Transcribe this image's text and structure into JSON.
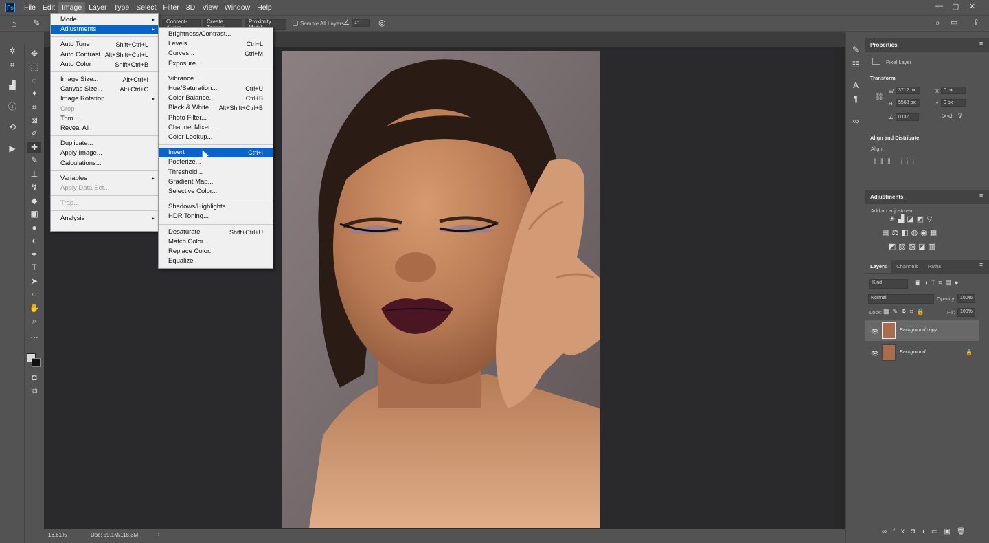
{
  "app": {
    "logo": "Ps"
  },
  "menubar": {
    "items": [
      "File",
      "Edit",
      "Image",
      "Layer",
      "Type",
      "Select",
      "Filter",
      "3D",
      "View",
      "Window",
      "Help"
    ],
    "active": "Image"
  },
  "options": {
    "content_aware": "Content-Aware",
    "create_texture": "Create Texture",
    "proximity_match": "Proximity Match",
    "sample_all_layers": "Sample All Layers",
    "angle": "1°"
  },
  "status": {
    "zoom": "16.61%",
    "doc": "Doc: 59.1M/118.3M"
  },
  "image_menu": [
    {
      "label": "Mode",
      "sub": true
    },
    {
      "label": "Adjustments",
      "sub": true,
      "highlight": true
    },
    {
      "sep": true
    },
    {
      "label": "Auto Tone",
      "shortcut": "Shift+Ctrl+L"
    },
    {
      "label": "Auto Contrast",
      "shortcut": "Alt+Shift+Ctrl+L"
    },
    {
      "label": "Auto Color",
      "shortcut": "Shift+Ctrl+B"
    },
    {
      "sep": true
    },
    {
      "label": "Image Size...",
      "shortcut": "Alt+Ctrl+I"
    },
    {
      "label": "Canvas Size...",
      "shortcut": "Alt+Ctrl+C"
    },
    {
      "label": "Image Rotation",
      "sub": true
    },
    {
      "label": "Crop",
      "disabled": true
    },
    {
      "label": "Trim..."
    },
    {
      "label": "Reveal All"
    },
    {
      "sep": true
    },
    {
      "label": "Duplicate..."
    },
    {
      "label": "Apply Image..."
    },
    {
      "label": "Calculations..."
    },
    {
      "sep": true
    },
    {
      "label": "Variables",
      "sub": true
    },
    {
      "label": "Apply Data Set...",
      "disabled": true
    },
    {
      "sep": true
    },
    {
      "label": "Trap...",
      "disabled": true
    },
    {
      "sep": true
    },
    {
      "label": "Analysis",
      "sub": true
    }
  ],
  "adjustments_menu": [
    {
      "label": "Brightness/Contrast..."
    },
    {
      "label": "Levels...",
      "shortcut": "Ctrl+L"
    },
    {
      "label": "Curves...",
      "shortcut": "Ctrl+M"
    },
    {
      "label": "Exposure..."
    },
    {
      "sep": true
    },
    {
      "label": "Vibrance..."
    },
    {
      "label": "Hue/Saturation...",
      "shortcut": "Ctrl+U"
    },
    {
      "label": "Color Balance...",
      "shortcut": "Ctrl+B"
    },
    {
      "label": "Black & White...",
      "shortcut": "Alt+Shift+Ctrl+B"
    },
    {
      "label": "Photo Filter..."
    },
    {
      "label": "Channel Mixer..."
    },
    {
      "label": "Color Lookup..."
    },
    {
      "sep": true
    },
    {
      "label": "Invert",
      "shortcut": "Ctrl+I",
      "highlight": true
    },
    {
      "label": "Posterize..."
    },
    {
      "label": "Threshold..."
    },
    {
      "label": "Gradient Map..."
    },
    {
      "label": "Selective Color..."
    },
    {
      "sep": true
    },
    {
      "label": "Shadows/Highlights..."
    },
    {
      "label": "HDR Toning..."
    },
    {
      "sep": true
    },
    {
      "label": "Desaturate",
      "shortcut": "Shift+Ctrl+U"
    },
    {
      "label": "Match Color..."
    },
    {
      "label": "Replace Color..."
    },
    {
      "label": "Equalize"
    }
  ],
  "properties": {
    "title": "Properties",
    "layer_type": "Pixel Layer",
    "transform": "Transform",
    "w_label": "W",
    "w": "3712 px",
    "h_label": "H",
    "h": "5568 px",
    "x_label": "X",
    "x": "0 px",
    "y_label": "Y",
    "y": "0 px",
    "angle": "0.00°",
    "align": "Align and Distribute",
    "align_label": "Align:"
  },
  "adjustments_panel": {
    "title": "Adjustments",
    "subtitle": "Add an adjustment"
  },
  "layers_panel": {
    "tabs": [
      "Layers",
      "Channels",
      "Paths"
    ],
    "kind": "Kind",
    "blend": "Normal",
    "opacity_label": "Opacity:",
    "opacity": "100%",
    "lock_label": "Lock:",
    "fill_label": "Fill:",
    "fill": "100%",
    "layers": [
      {
        "name": "Background copy",
        "selected": true
      },
      {
        "name": "Background",
        "locked": true
      }
    ]
  }
}
